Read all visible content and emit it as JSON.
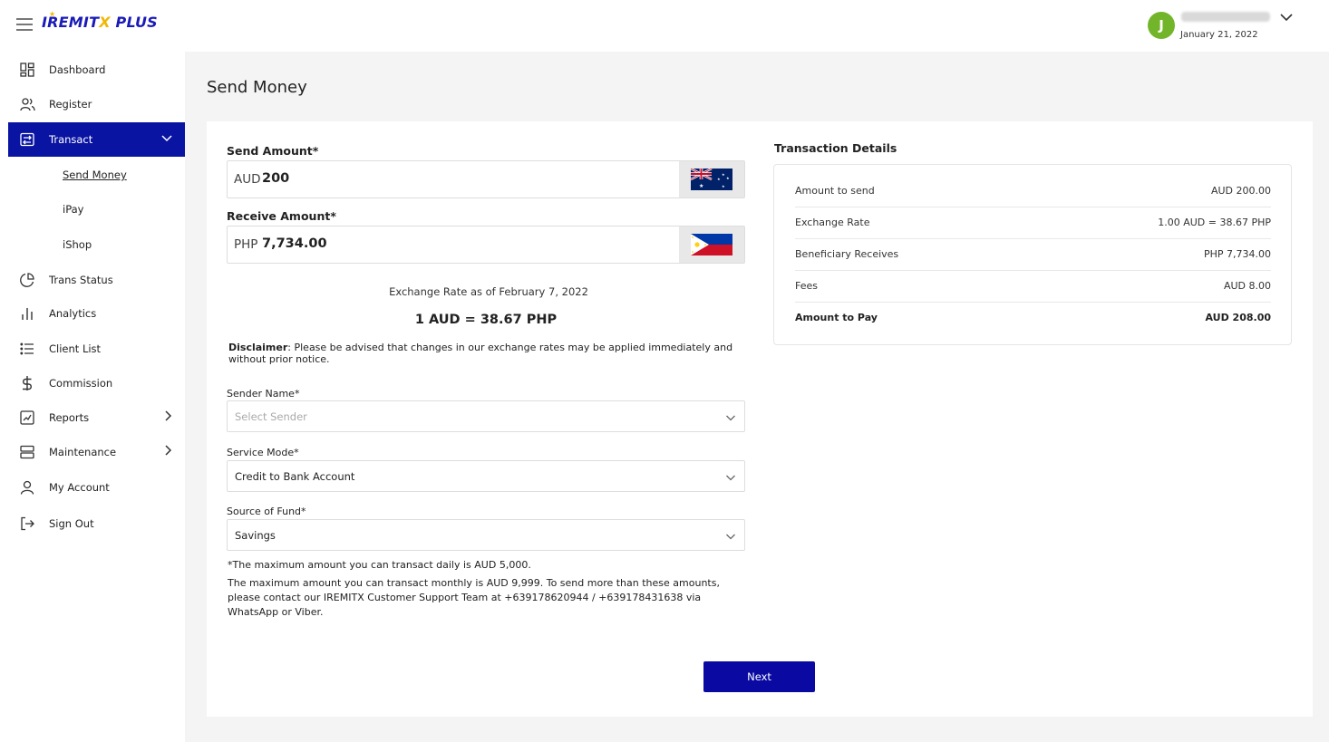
{
  "header": {
    "logo_text_1": "IREMIT",
    "logo_text_x": "X",
    "logo_text_2": " PLUS",
    "avatar_initial": "J",
    "date": "January 21, 2022"
  },
  "sidebar": {
    "items": [
      {
        "label": "Dashboard",
        "icon": "dashboard-icon"
      },
      {
        "label": "Register",
        "icon": "users-icon"
      },
      {
        "label": "Transact",
        "icon": "transact-icon"
      },
      {
        "label": "Trans Status",
        "icon": "pie-chart-icon"
      },
      {
        "label": "Analytics",
        "icon": "bar-chart-icon"
      },
      {
        "label": "Client List",
        "icon": "list-icon"
      },
      {
        "label": "Commission",
        "icon": "dollar-icon"
      },
      {
        "label": "Reports",
        "icon": "line-chart-icon"
      },
      {
        "label": "Maintenance",
        "icon": "server-icon"
      },
      {
        "label": "My Account",
        "icon": "user-icon"
      },
      {
        "label": "Sign Out",
        "icon": "sign-out-icon"
      }
    ],
    "sub_items": [
      "Send Money",
      "iPay",
      "iShop"
    ]
  },
  "page": {
    "title": "Send Money"
  },
  "form": {
    "send_amount_label": "Send Amount*",
    "send_currency": "AUD",
    "send_value": "200",
    "receive_amount_label": "Receive Amount*",
    "receive_currency": "PHP",
    "receive_value": "7,734.00",
    "exchange_rate_caption": "Exchange Rate as of February 7, 2022",
    "exchange_rate": "1 AUD = 38.67 PHP",
    "disclaimer_label": "Disclaimer",
    "disclaimer_text": ": Please be advised that changes in our exchange rates may be applied immediately and without prior notice.",
    "sender_name_label": "Sender Name*",
    "sender_name_placeholder": "Select Sender",
    "service_mode_label": "Service Mode*",
    "service_mode_value": "Credit to Bank Account",
    "source_of_fund_label": "Source of Fund*",
    "source_of_fund_value": "Savings",
    "note_daily": "*The maximum amount you can transact daily is AUD 5,000.",
    "note_monthly": "The maximum amount you can transact monthly is AUD 9,999. To send more than these amounts, please contact our IREMITX Customer Support Team at +639178620944 / +639178431638 via WhatsApp or Viber.",
    "next_button": "Next"
  },
  "transaction_details": {
    "title": "Transaction Details",
    "rows": [
      {
        "label": "Amount to send",
        "value": "AUD 200.00"
      },
      {
        "label": "Exchange Rate",
        "value": "1.00 AUD = 38.67 PHP"
      },
      {
        "label": "Beneficiary Receives",
        "value": "PHP 7,734.00"
      },
      {
        "label": "Fees",
        "value": "AUD 8.00"
      },
      {
        "label": "Amount to Pay",
        "value": "AUD 208.00"
      }
    ]
  },
  "colors": {
    "primary": "#0a14a3",
    "avatar": "#72b52a",
    "logo_accent": "#f2b705"
  }
}
